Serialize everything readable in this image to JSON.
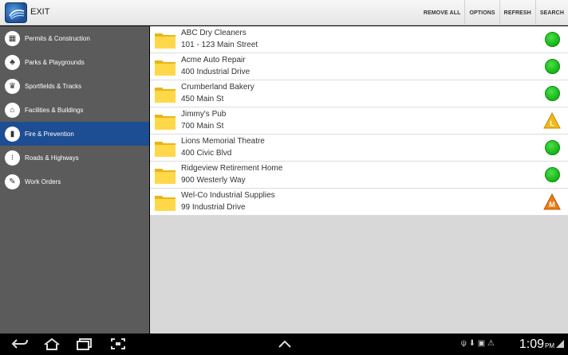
{
  "topbar": {
    "exit_label": "EXIT",
    "actions": [
      "REMOVE ALL",
      "OPTIONS",
      "REFRESH",
      "SEARCH"
    ]
  },
  "sidebar": {
    "items": [
      {
        "label": "Permits & Construction",
        "icon": "building-icon"
      },
      {
        "label": "Parks & Playgrounds",
        "icon": "tree-icon"
      },
      {
        "label": "Sportfields & Tracks",
        "icon": "trophy-icon"
      },
      {
        "label": "Facilities & Buildings",
        "icon": "warehouse-icon"
      },
      {
        "label": "Fire & Prevention",
        "icon": "extinguisher-icon"
      },
      {
        "label": "Roads & Highways",
        "icon": "traffic-light-icon"
      },
      {
        "label": "Work Orders",
        "icon": "clipboard-icon"
      }
    ],
    "active_index": 4,
    "active_color": "#1d4d92"
  },
  "list": {
    "rows": [
      {
        "name": "ABC Dry Cleaners",
        "address": "101 - 123 Main Street",
        "status": "green"
      },
      {
        "name": "Acme Auto Repair",
        "address": "400 Industrial Drive",
        "status": "green"
      },
      {
        "name": "Crumberland Bakery",
        "address": "450 Main St",
        "status": "green"
      },
      {
        "name": "Jimmy's Pub",
        "address": "700 Main St",
        "status": "warning",
        "status_letter": "L",
        "status_color": "#f2b81c"
      },
      {
        "name": "Lions Memorial Theatre",
        "address": "400 Civic Blvd",
        "status": "green"
      },
      {
        "name": "Ridgeview Retirement Home",
        "address": "900 Westerly Way",
        "status": "green"
      },
      {
        "name": "Wel-Co Industrial Supplies",
        "address": "99 Industrial Drive",
        "status": "warning",
        "status_letter": "M",
        "status_color": "#f07b14"
      }
    ]
  },
  "navbar": {
    "clock": "1:09",
    "ampm": "PM"
  }
}
